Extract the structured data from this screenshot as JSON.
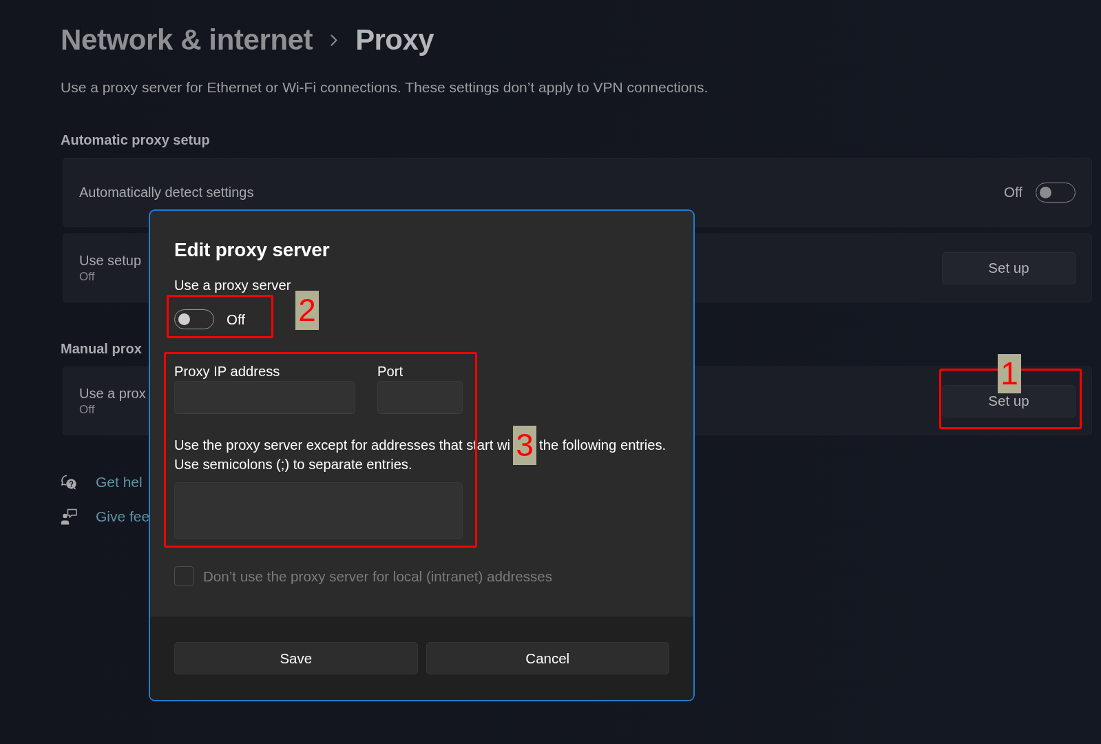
{
  "breadcrumb": {
    "parent": "Network & internet",
    "current": "Proxy"
  },
  "description": "Use a proxy server for Ethernet or Wi-Fi connections. These settings don’t apply to VPN connections.",
  "sections": [
    {
      "heading": "Automatic proxy setup",
      "rows": [
        {
          "kind": "toggle",
          "title": "Automatically detect settings",
          "state_label": "Off",
          "on": false
        },
        {
          "kind": "button",
          "title": "Use setup",
          "subtitle": "Off",
          "button": "Set up"
        }
      ]
    },
    {
      "heading": "Manual prox",
      "rows": [
        {
          "kind": "button",
          "title": "Use a prox",
          "subtitle": "Off",
          "button": "Set up",
          "callout": "1"
        }
      ]
    }
  ],
  "links": [
    {
      "kind": "help",
      "label": "Get hel"
    },
    {
      "kind": "feedback",
      "label": "Give fee"
    }
  ],
  "dialog": {
    "title": "Edit proxy server",
    "proxy_switch": {
      "label": "Use a proxy server",
      "on": false,
      "state_label": "Off",
      "callout": "2"
    },
    "address": {
      "callout": "3",
      "fields": [
        {
          "kind": "wide",
          "label": "Proxy IP address"
        },
        {
          "kind": "narrow",
          "label": "Port"
        }
      ],
      "exceptions": {
        "before_marker": "Use the proxy server except for addresses that start wi",
        "after_marker": "the following entries.",
        "second_line": "Use semicolons (;) to separate entries."
      }
    },
    "local_addresses": {
      "label": "Don’t use the proxy server for local (intranet) addresses",
      "checked": false,
      "disabled": true
    },
    "buttons": [
      {
        "label": "Save"
      },
      {
        "label": "Cancel"
      }
    ]
  }
}
